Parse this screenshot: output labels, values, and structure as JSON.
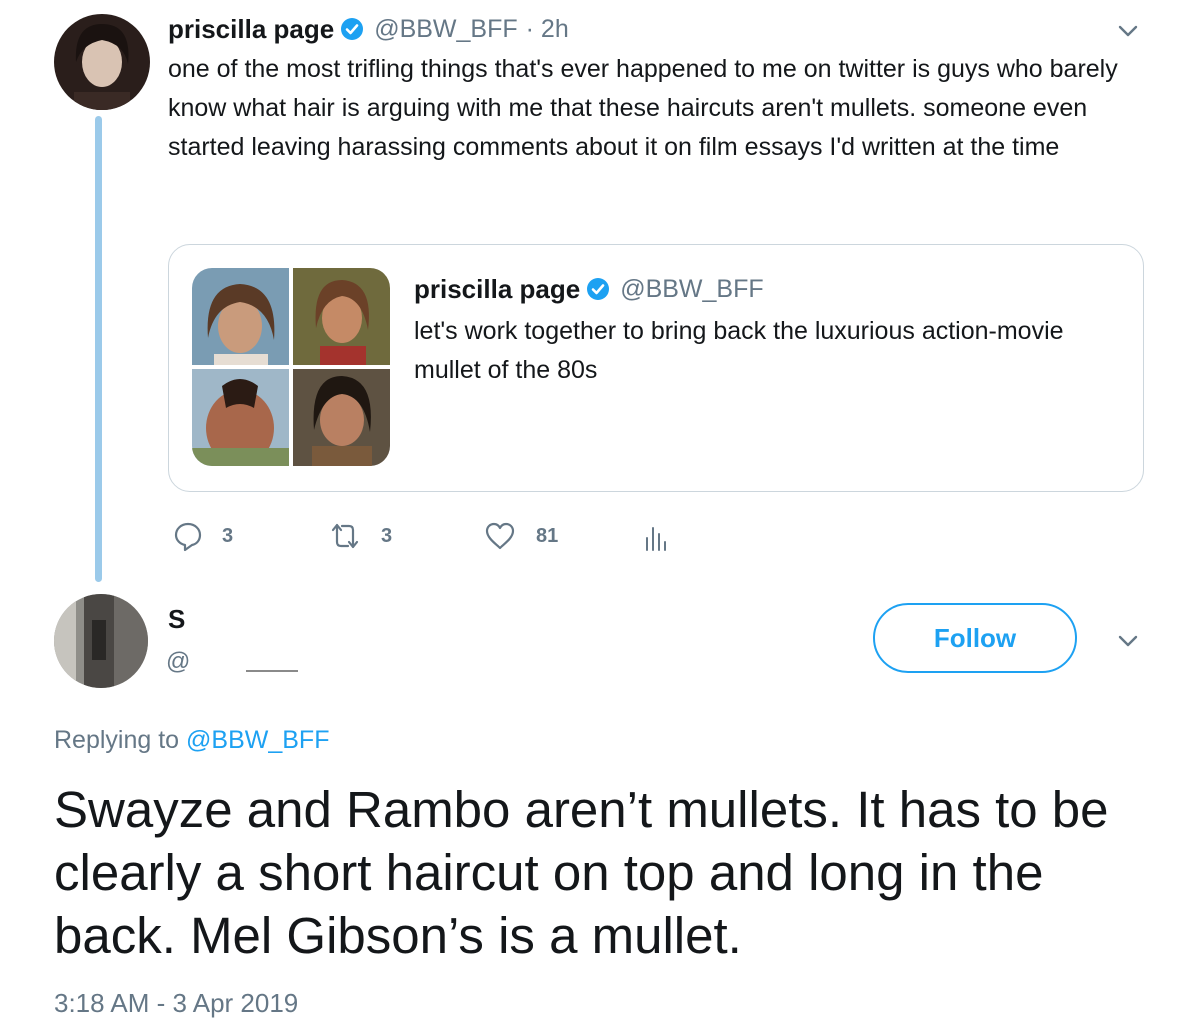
{
  "tweet": {
    "author_name": "priscilla page",
    "handle": "@BBW_BFF",
    "time": "· 2h",
    "text": "one of the most trifling things that's ever happened to me on twitter is guys who barely know what hair is arguing with me that these haircuts aren't mullets. someone even started leaving harassing comments about it on film essays I'd written at the time",
    "actions": {
      "replies": "3",
      "retweets": "3",
      "likes": "81"
    }
  },
  "quoted": {
    "author_name": "priscilla page",
    "handle": "@BBW_BFF",
    "text": "let's work together to bring back the luxurious action-movie mullet of the 80s"
  },
  "reply": {
    "name_partial": "S",
    "handle_partial": "@",
    "follow_label": "Follow",
    "replying_prefix": "Replying to",
    "replying_handle": "@BBW_BFF",
    "text": "Swayze and Rambo aren’t mullets. It has to be clearly a short haircut on top and long in the back. Mel Gibson’s is a mullet.",
    "timestamp": "3:18 AM - 3 Apr 2019"
  },
  "icons": [
    "verified-badge-icon",
    "chevron-down-icon",
    "reply-icon",
    "retweet-icon",
    "like-icon",
    "analytics-icon"
  ],
  "colors": {
    "accent": "#1da1f2",
    "muted": "#657786",
    "text": "#14171a",
    "thread_line": "#9bcaea",
    "border": "#ccd6dd"
  }
}
